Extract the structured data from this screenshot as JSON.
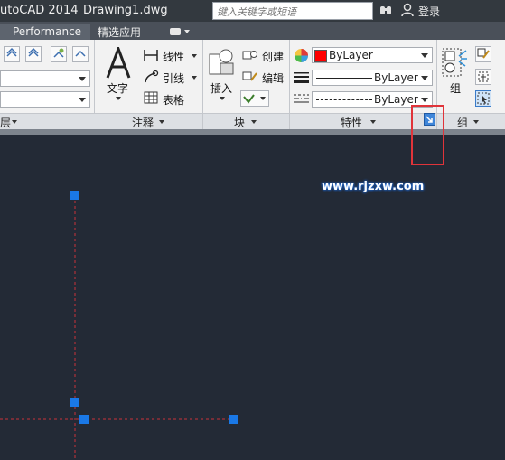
{
  "titlebar": {
    "app_title": "utoCAD 2014",
    "document": "Drawing1.dwg",
    "search_placeholder": "键入关键字或短语",
    "login": "登录"
  },
  "tabs": {
    "performance": "Performance",
    "featured_apps": "精选应用"
  },
  "panels": {
    "annotation": {
      "title": "注释",
      "text_button": "文字",
      "linear": "线性",
      "leader": "引线",
      "table": "表格"
    },
    "block": {
      "title": "块",
      "insert": "插入",
      "create": "创建",
      "edit": "编辑"
    },
    "properties": {
      "title": "特性",
      "color": "ByLayer",
      "linetype": "ByLayer",
      "lineweight": "ByLayer"
    },
    "group": {
      "title": "组",
      "group_button": "组"
    },
    "left_partial_title": "层"
  },
  "canvas": {
    "watermark": "www.rjzxw.com"
  },
  "colors": {
    "canvas_bg": "#232a36",
    "grip": "#1a78e6",
    "highlight": "#e0343a",
    "color_swatch": "#ff0000"
  }
}
